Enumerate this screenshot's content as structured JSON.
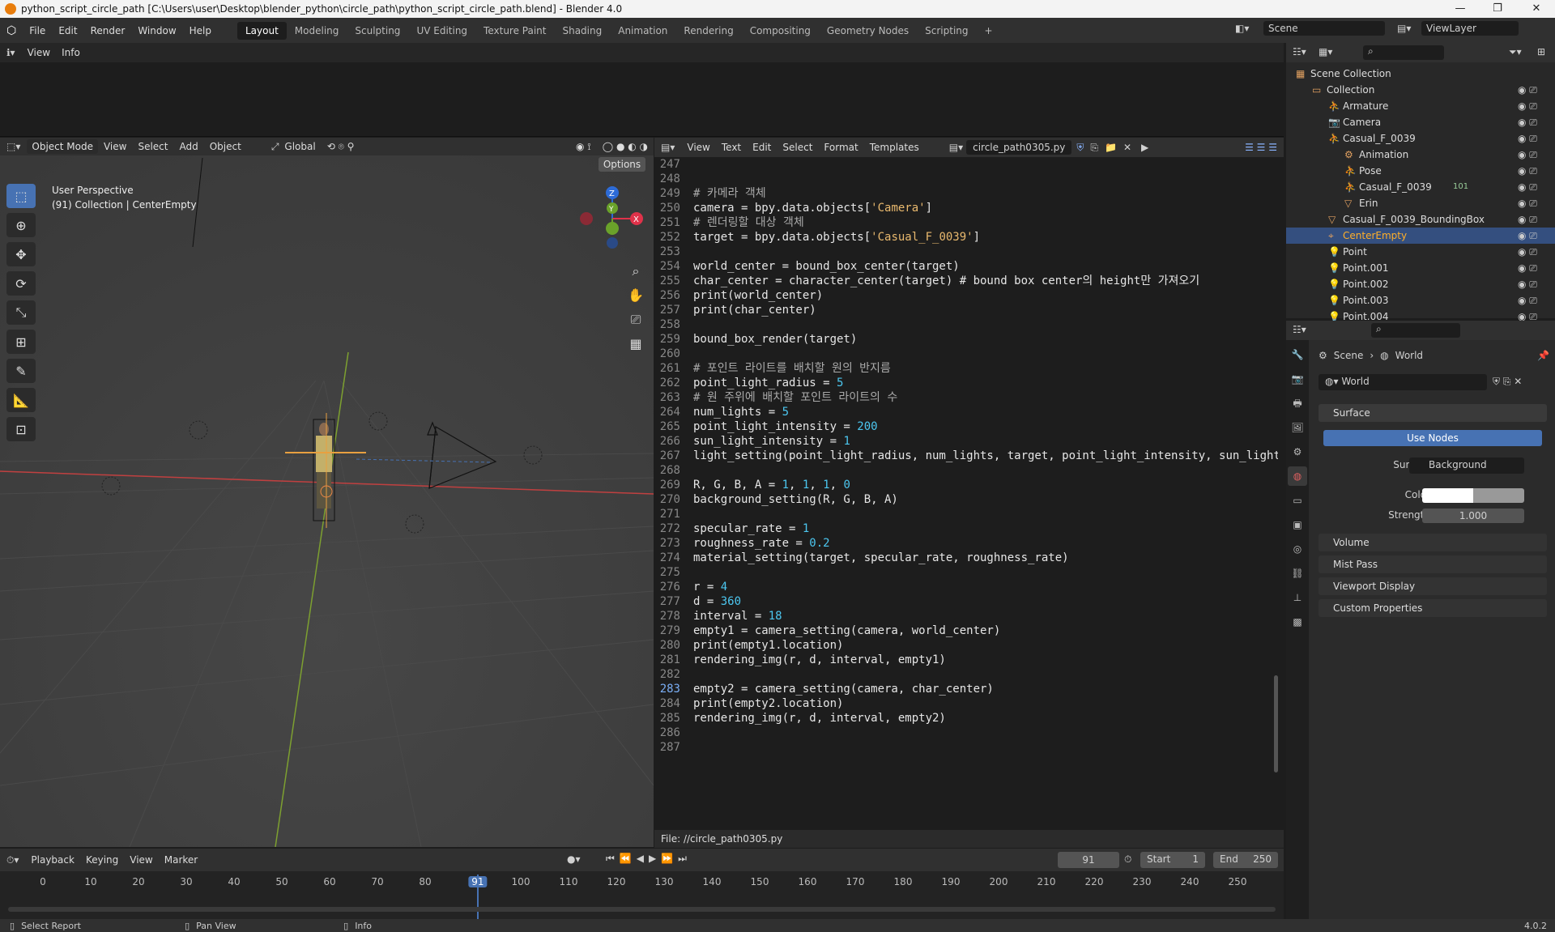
{
  "titlebar": {
    "title": "python_script_circle_path [C:\\Users\\user\\Desktop\\blender_python\\circle_path\\python_script_circle_path.blend] - Blender 4.0",
    "minimize": "—",
    "maximize": "❐",
    "close": "✕"
  },
  "menubar": {
    "menus": [
      "File",
      "Edit",
      "Render",
      "Window",
      "Help"
    ],
    "workspaces": [
      "Layout",
      "Modeling",
      "Sculpting",
      "UV Editing",
      "Texture Paint",
      "Shading",
      "Animation",
      "Rendering",
      "Compositing",
      "Geometry Nodes",
      "Scripting"
    ],
    "add": "+",
    "scene": "Scene",
    "viewlayer": "ViewLayer"
  },
  "info": {
    "menus": [
      "View",
      "Info"
    ]
  },
  "viewport": {
    "mode": "Object Mode",
    "menus": [
      "View",
      "Select",
      "Add",
      "Object"
    ],
    "transform": "Global",
    "options": "Options",
    "perspective": "User Perspective",
    "collection": "(91) Collection | CenterEmpty",
    "axes": {
      "x": "X",
      "y": "Y",
      "z": "Z"
    }
  },
  "texteditor": {
    "menus": [
      "View",
      "Text",
      "Edit",
      "Select",
      "Format",
      "Templates"
    ],
    "filename": "circle_path0305.py",
    "footer": "File: //circle_path0305.py",
    "lines": [
      {
        "n": "247",
        "t": ""
      },
      {
        "n": "248",
        "t": ""
      },
      {
        "n": "249",
        "t": "# 카메라 객체"
      },
      {
        "n": "250",
        "t": "camera = bpy.data.objects['Camera']"
      },
      {
        "n": "251",
        "t": "# 렌더링할 대상 객체"
      },
      {
        "n": "252",
        "t": "target = bpy.data.objects['Casual_F_0039']"
      },
      {
        "n": "253",
        "t": ""
      },
      {
        "n": "254",
        "t": "world_center = bound_box_center(target)"
      },
      {
        "n": "255",
        "t": "char_center = character_center(target) # bound box center의 height만 가져오기"
      },
      {
        "n": "256",
        "t": "print(world_center)"
      },
      {
        "n": "257",
        "t": "print(char_center)"
      },
      {
        "n": "258",
        "t": ""
      },
      {
        "n": "259",
        "t": "bound_box_render(target)"
      },
      {
        "n": "260",
        "t": ""
      },
      {
        "n": "261",
        "t": "# 포인트 라이트를 배치할 원의 반지름"
      },
      {
        "n": "262",
        "t": "point_light_radius = 5"
      },
      {
        "n": "263",
        "t": "# 원 주위에 배치할 포인트 라이트의 수"
      },
      {
        "n": "264",
        "t": "num_lights = 5"
      },
      {
        "n": "265",
        "t": "point_light_intensity = 200"
      },
      {
        "n": "266",
        "t": "sun_light_intensity = 1"
      },
      {
        "n": "267",
        "t": "light_setting(point_light_radius, num_lights, target, point_light_intensity, sun_light_int"
      },
      {
        "n": "268",
        "t": ""
      },
      {
        "n": "269",
        "t": "R, G, B, A = 1, 1, 1, 0"
      },
      {
        "n": "270",
        "t": "background_setting(R, G, B, A)"
      },
      {
        "n": "271",
        "t": ""
      },
      {
        "n": "272",
        "t": "specular_rate = 1"
      },
      {
        "n": "273",
        "t": "roughness_rate = 0.2"
      },
      {
        "n": "274",
        "t": "material_setting(target, specular_rate, roughness_rate)"
      },
      {
        "n": "275",
        "t": ""
      },
      {
        "n": "276",
        "t": "r = 4"
      },
      {
        "n": "277",
        "t": "d = 360"
      },
      {
        "n": "278",
        "t": "interval = 18"
      },
      {
        "n": "279",
        "t": "empty1 = camera_setting(camera, world_center)"
      },
      {
        "n": "280",
        "t": "print(empty1.location)"
      },
      {
        "n": "281",
        "t": "rendering_img(r, d, interval, empty1)"
      },
      {
        "n": "282",
        "t": ""
      },
      {
        "n": "283",
        "t": "empty2 = camera_setting(camera, char_center)"
      },
      {
        "n": "284",
        "t": "print(empty2.location)"
      },
      {
        "n": "285",
        "t": "rendering_img(r, d, interval, empty2)"
      },
      {
        "n": "286",
        "t": ""
      },
      {
        "n": "287",
        "t": ""
      }
    ]
  },
  "timeline": {
    "menus": [
      "Playback",
      "Keying",
      "View",
      "Marker"
    ],
    "current": "91",
    "start_label": "Start",
    "start": "1",
    "end_label": "End",
    "end": "250",
    "ticks": [
      "0",
      "10",
      "20",
      "30",
      "40",
      "50",
      "60",
      "70",
      "80",
      "91",
      "100",
      "110",
      "120",
      "130",
      "140",
      "150",
      "160",
      "170",
      "180",
      "190",
      "200",
      "210",
      "220",
      "230",
      "240",
      "250"
    ]
  },
  "statusbar": {
    "left": "Select Report",
    "mid": "Pan View",
    "right": "Info",
    "version": "4.0.2"
  },
  "outliner": {
    "items": [
      {
        "label": "Scene Collection",
        "level": 0
      },
      {
        "label": "Collection",
        "level": 1
      },
      {
        "label": "Armature",
        "level": 2
      },
      {
        "label": "Camera",
        "level": 2
      },
      {
        "label": "Casual_F_0039",
        "level": 2
      },
      {
        "label": "Animation",
        "level": 3
      },
      {
        "label": "Pose",
        "level": 3
      },
      {
        "label": "Casual_F_0039",
        "level": 3
      },
      {
        "label": "Erin",
        "level": 3
      },
      {
        "label": "Casual_F_0039_BoundingBox",
        "level": 2
      },
      {
        "label": "CenterEmpty",
        "level": 2,
        "selected": true
      },
      {
        "label": "Point",
        "level": 2
      },
      {
        "label": "Point.001",
        "level": 2
      },
      {
        "label": "Point.002",
        "level": 2
      },
      {
        "label": "Point.003",
        "level": 2
      },
      {
        "label": "Point.004",
        "level": 2
      }
    ],
    "badge": "101"
  },
  "properties": {
    "breadcrumb_scene": "Scene",
    "breadcrumb_world": "World",
    "world_name": "World",
    "surface": "Surface",
    "use_nodes": "Use Nodes",
    "surface_label": "Surface",
    "surface_value": "Background",
    "color_label": "Color",
    "strength_label": "Strength",
    "strength_value": "1.000",
    "panels": [
      "Volume",
      "Mist Pass",
      "Viewport Display",
      "Custom Properties"
    ]
  },
  "colors": {
    "accent": "#4772b3",
    "selected": "#344f7f",
    "timeline_current": "#4772b3"
  }
}
